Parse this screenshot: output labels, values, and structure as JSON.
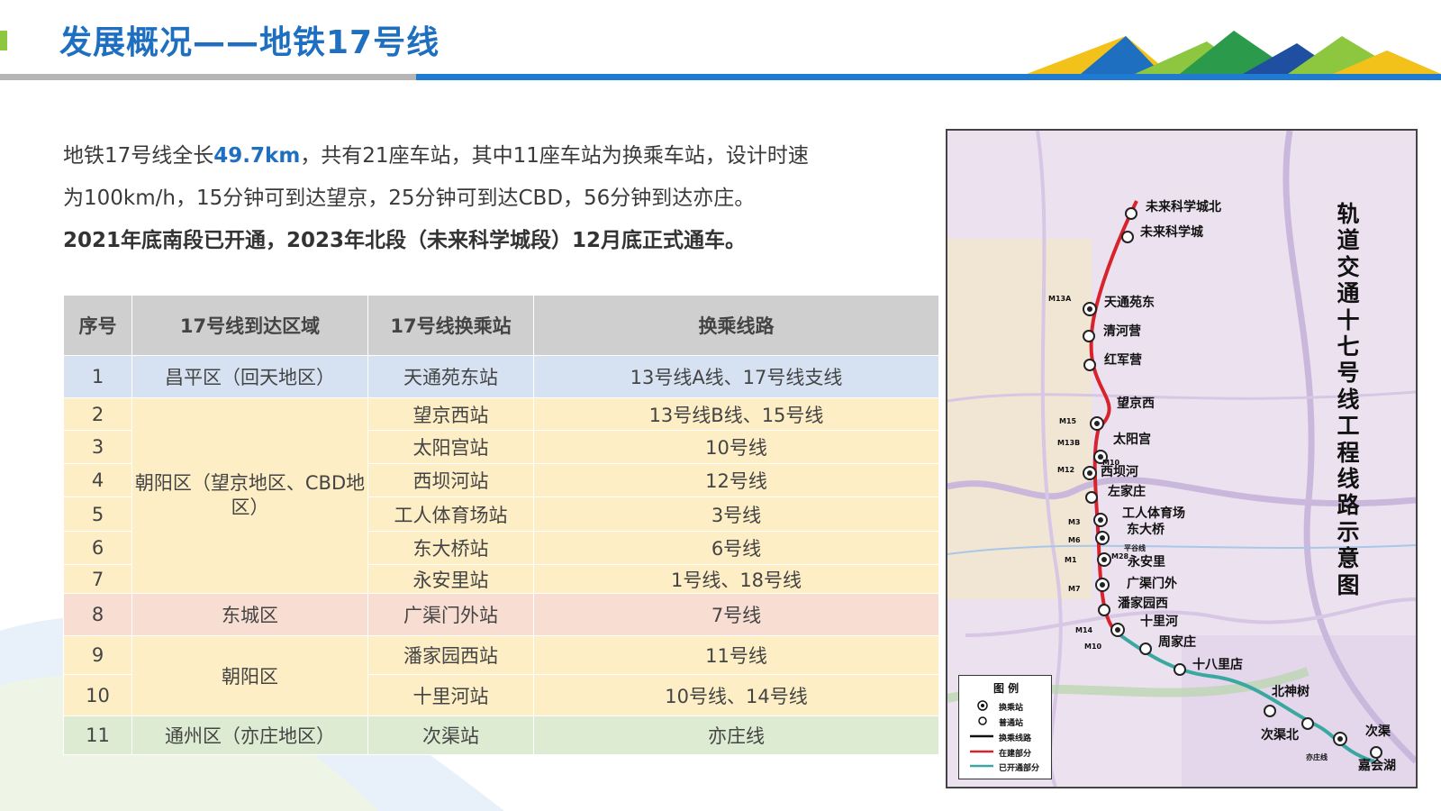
{
  "header": {
    "title": "发展概况——地铁17号线"
  },
  "intro": {
    "line1_a": "地铁17号线全长",
    "line1_length": "49.7km",
    "line1_b": "，共有21座车站，其中11座车站为换乘车站，设计时速",
    "line2": "为100km/h，15分钟可到达望京，25分钟可到达CBD，56分钟到达亦庄。",
    "line3": "2021年底南段已开通，2023年北段（未来科学城段）12月底正式通车。"
  },
  "table": {
    "headers": [
      "序号",
      "17号线到达区域",
      "17号线换乘站",
      "换乘线路"
    ],
    "rows": [
      {
        "no": "1",
        "area": "昌平区（回天地区）",
        "station": "天通苑东站",
        "lines": "13号线A线、17号线支线"
      },
      {
        "no": "2",
        "area": "朝阳区（望京地区、CBD地区）",
        "station": "望京西站",
        "lines": "13号线B线、15号线"
      },
      {
        "no": "3",
        "station": "太阳宫站",
        "lines": "10号线"
      },
      {
        "no": "4",
        "station": "西坝河站",
        "lines": "12号线"
      },
      {
        "no": "5",
        "station": "工人体育场站",
        "lines": "3号线"
      },
      {
        "no": "6",
        "station": "东大桥站",
        "lines": "6号线"
      },
      {
        "no": "7",
        "station": "永安里站",
        "lines": "1号线、18号线"
      },
      {
        "no": "8",
        "area": "东城区",
        "station": "广渠门外站",
        "lines": "7号线"
      },
      {
        "no": "9",
        "area": "朝阳区",
        "station": "潘家园西站",
        "lines": "11号线"
      },
      {
        "no": "10",
        "station": "十里河站",
        "lines": "10号线、14号线"
      },
      {
        "no": "11",
        "area": "通州区（亦庄地区）",
        "station": "次渠站",
        "lines": "亦庄线"
      }
    ]
  },
  "map": {
    "title": "轨道交通十七号线工程线路示意图",
    "stations": [
      "未来科学城北",
      "未来科学城",
      "天通苑东",
      "清河营",
      "红军营",
      "望京西",
      "太阳宫",
      "西坝河",
      "左家庄",
      "工人体育场",
      "东大桥",
      "永安里",
      "广渠门外",
      "潘家园西",
      "十里河",
      "周家庄",
      "十八里店",
      "北神树",
      "次渠北",
      "次渠",
      "嘉会湖"
    ],
    "line_markers": [
      "M13A",
      "M15",
      "M13B",
      "M10",
      "M12",
      "M3",
      "M6",
      "M28",
      "M1",
      "M7",
      "M14",
      "M10"
    ],
    "branch_labels": [
      "平谷线",
      "亦庄线"
    ],
    "legend": {
      "title": "图 例",
      "items": [
        "换乘站",
        "普通站",
        "换乘线路",
        "在建部分",
        "已开通部分"
      ]
    },
    "colors": {
      "under_construction": "#d7232b",
      "opened": "#3aa8a0",
      "transfer_line": "#111111"
    }
  },
  "colors": {
    "title": "#1f6fc1",
    "accent_green": "#8dc63f",
    "header_row": "#cfcfcf"
  }
}
